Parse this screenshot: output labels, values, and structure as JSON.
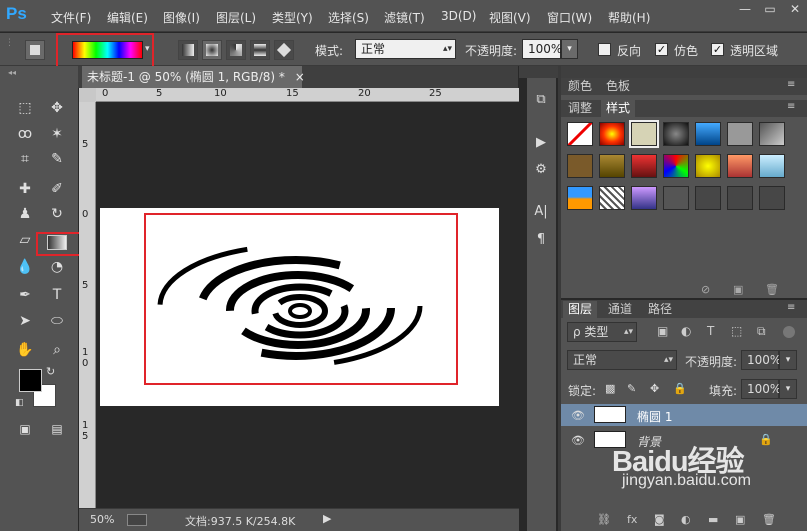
{
  "app": {
    "logo": "Ps"
  },
  "menu": [
    "文件(F)",
    "编辑(E)",
    "图像(I)",
    "图层(L)",
    "类型(Y)",
    "选择(S)",
    "滤镜(T)",
    "3D(D)",
    "视图(V)",
    "窗口(W)",
    "帮助(H)"
  ],
  "window": {
    "minimize": "—",
    "restore": "▭",
    "close": "✕"
  },
  "options": {
    "mode_label": "模式:",
    "mode_value": "正常",
    "opacity_label": "不透明度:",
    "opacity_value": "100%",
    "reverse_label": "反向",
    "dither_label": "仿色",
    "transparency_label": "透明区域",
    "reverse_checked": false,
    "dither_checked": true,
    "transparency_checked": true,
    "gradient_colors": [
      "#ff0000",
      "#ffff00",
      "#00ff00",
      "#00ffff",
      "#0000ff",
      "#ff00ff",
      "#ff0000"
    ]
  },
  "document": {
    "tab_title": "未标题-1 @ 50% (椭圆 1, RGB/8) *",
    "tab_close": "×",
    "ruler_top": [
      "0",
      "5",
      "10",
      "15",
      "20",
      "25"
    ],
    "ruler_left": [
      "5",
      "0",
      "5",
      "1",
      "0",
      "1",
      "5"
    ]
  },
  "status": {
    "zoom": "50%",
    "doc_info": "文档:937.5 K/254.8K"
  },
  "panels": {
    "color_tab": "颜色",
    "swatches_tab": "色板",
    "adjust_tab": "调整",
    "styles_tab": "样式",
    "layers_tab": "图层",
    "channels_tab": "通道",
    "paths_tab": "路径"
  },
  "layers": {
    "filter_label": "ρ 类型",
    "blend_mode": "正常",
    "opacity_label": "不透明度:",
    "opacity_value": "100%",
    "lock_label": "锁定:",
    "fill_label": "填充:",
    "fill_value": "100%",
    "items": [
      {
        "name": "椭圆 1",
        "selected": true
      },
      {
        "name": "背景",
        "selected": false
      }
    ]
  },
  "watermark": {
    "brand": "Baidu经验",
    "url": "jingyan.baidu.com"
  },
  "colors": {
    "fg": "#000000",
    "bg": "#ffffff",
    "highlight": "#e0242a",
    "selected_layer": "#6f8aa8"
  }
}
